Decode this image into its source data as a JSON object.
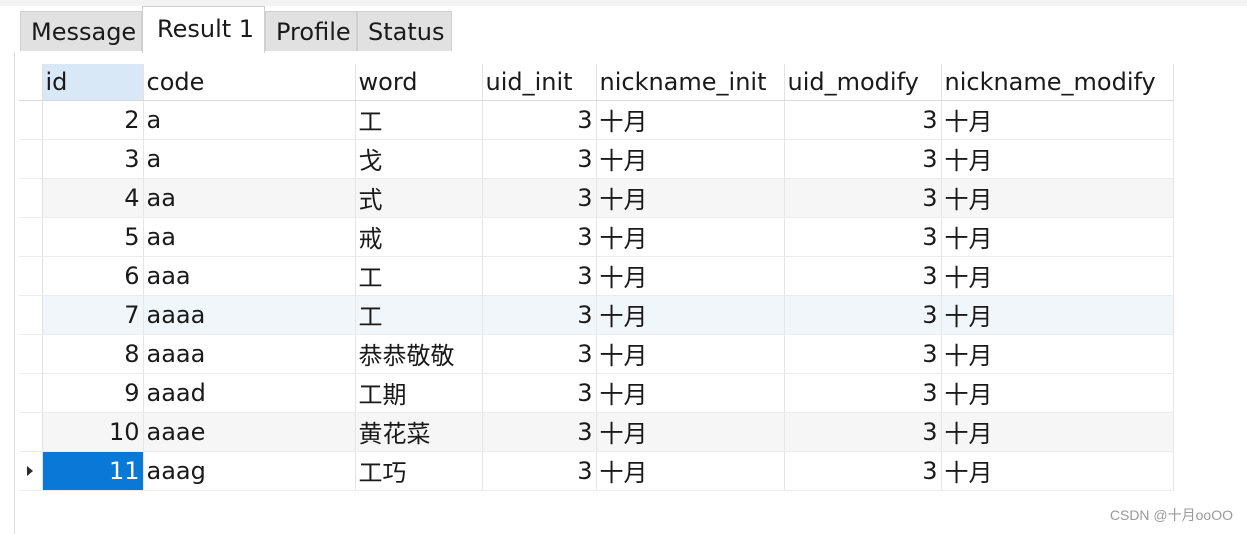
{
  "tabs": [
    {
      "label": "Message",
      "active": false
    },
    {
      "label": "Result 1",
      "active": true
    },
    {
      "label": "Profile",
      "active": false
    },
    {
      "label": "Status",
      "active": false
    }
  ],
  "grid": {
    "columns": [
      "id",
      "code",
      "word",
      "uid_init",
      "nickname_init",
      "uid_modify",
      "nickname_modify"
    ],
    "rows": [
      [
        "2",
        "a",
        "工",
        "3",
        "十月",
        "3",
        "十月"
      ],
      [
        "3",
        "a",
        "戈",
        "3",
        "十月",
        "3",
        "十月"
      ],
      [
        "4",
        "aa",
        "式",
        "3",
        "十月",
        "3",
        "十月"
      ],
      [
        "5",
        "aa",
        "戒",
        "3",
        "十月",
        "3",
        "十月"
      ],
      [
        "6",
        "aaa",
        "工",
        "3",
        "十月",
        "3",
        "十月"
      ],
      [
        "7",
        "aaaa",
        "工",
        "3",
        "十月",
        "3",
        "十月"
      ],
      [
        "8",
        "aaaa",
        "恭恭敬敬",
        "3",
        "十月",
        "3",
        "十月"
      ],
      [
        "9",
        "aaad",
        "工期",
        "3",
        "十月",
        "3",
        "十月"
      ],
      [
        "10",
        "aaae",
        "黄花菜",
        "3",
        "十月",
        "3",
        "十月"
      ],
      [
        "11",
        "aaag",
        "工巧",
        "3",
        "十月",
        "3",
        "十月"
      ]
    ],
    "selected_row": 9,
    "current_row_indicator": "caret-right-icon"
  },
  "watermark": "CSDN @十月ooOO",
  "colors": {
    "selection": "#0a78d6",
    "sorted_header": "#d9e8f7"
  }
}
